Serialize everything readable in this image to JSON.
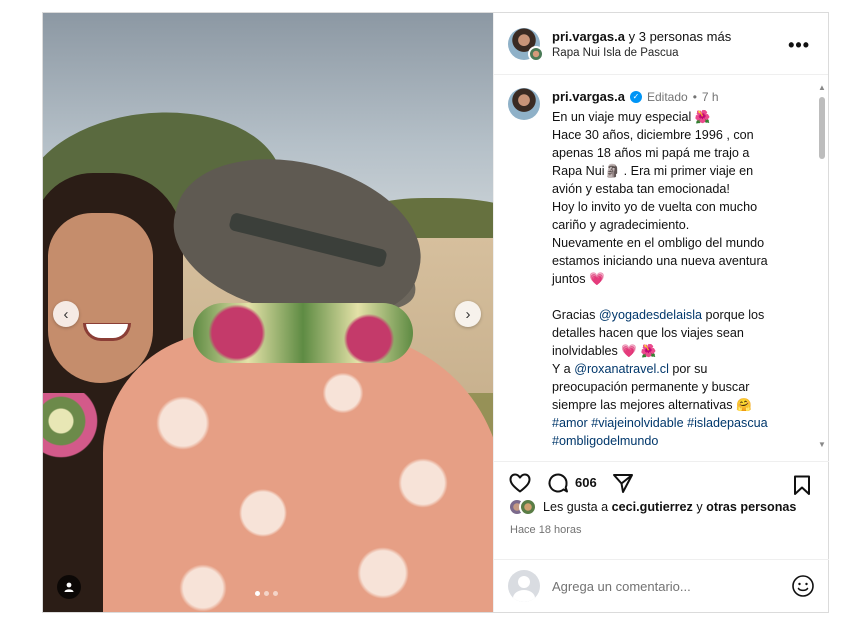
{
  "header": {
    "username": "pri.vargas.a",
    "coauthors": "y 3 personas más",
    "location": "Rapa Nui Isla de Pascua",
    "more_label": "•••"
  },
  "caption": {
    "username": "pri.vargas.a",
    "edited": "Editado",
    "separator": "•",
    "age": "7 h",
    "lines": [
      "En un viaje muy especial 🌺",
      "Hace 30 años, diciembre 1996 , con",
      "apenas 18 años mi papá me trajo a",
      "Rapa Nui🗿 . Era mi primer viaje en",
      "avión y estaba tan emocionada!",
      "Hoy lo invito yo de vuelta con mucho",
      "cariño y agradecimiento.",
      "Nuevamente en el ombligo del mundo",
      "estamos iniciando una nueva aventura",
      "juntos 💗"
    ],
    "thanks_prefix": "Gracias ",
    "mention1": "@yogadesdelaisla",
    "thanks_suffix": " porque los",
    "thanks_line2": "detalles hacen que los viajes sean",
    "thanks_line3": "inolvidables 💗 🌺",
    "and_prefix": "Y a ",
    "mention2": "@roxanatravel.cl",
    "and_suffix": " por su",
    "and_line2": "preocupación permanente y buscar",
    "and_line3": "siempre las mejores alternativas 🤗",
    "hashtags1": "#amor #viajeinolvidable #isladepascua",
    "hashtags2": "#ombligodelmundo"
  },
  "actions": {
    "like_icon": "heart-icon",
    "comment_icon": "comment-icon",
    "comment_count": "606",
    "share_icon": "send-icon",
    "save_icon": "bookmark-icon"
  },
  "likes": {
    "prefix": "Les gusta a ",
    "user": "ceci.gutierrez",
    "middle": " y ",
    "others": "otras personas"
  },
  "timestamp": "Hace 18 horas",
  "comment_box": {
    "placeholder": "Agrega un comentario..."
  },
  "carousel": {
    "prev": "‹",
    "next": "›",
    "slide_count": 3,
    "active_slide": 1
  },
  "colors": {
    "link": "#00376b",
    "verified": "#0095f6"
  }
}
